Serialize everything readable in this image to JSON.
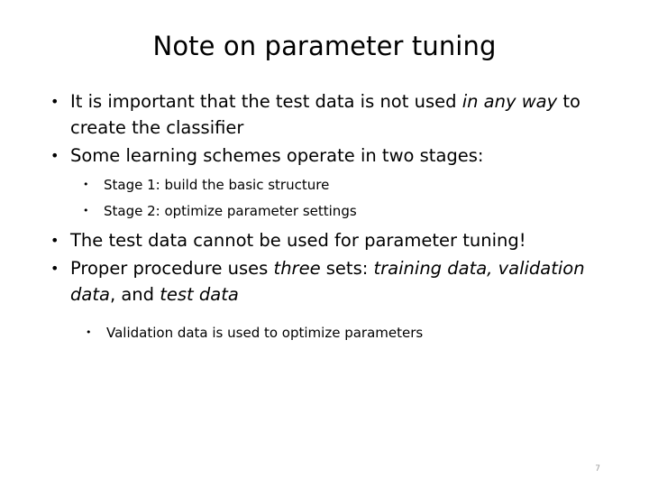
{
  "slide": {
    "title": "Note on parameter tuning",
    "page_number": "7",
    "background_color": "#ffffff",
    "text_color": "#000000",
    "page_number_color": "#9a9a9a",
    "bullets": [
      {
        "level": 1,
        "text_parts": [
          {
            "text": "It is important that the test data is not used ",
            "style": "normal"
          },
          {
            "text": "in any way",
            "style": "italic"
          },
          {
            "text": " to create the classifier",
            "style": "normal"
          }
        ],
        "plain_text": "It is important that the test data is not used in any way to create the classifier"
      },
      {
        "level": 1,
        "text_parts": [
          {
            "text": "Some learning schemes operate in two stages:",
            "style": "normal"
          }
        ],
        "plain_text": "Some learning schemes operate in two stages:"
      },
      {
        "level": 2,
        "text_parts": [
          {
            "text": "Stage 1: build the basic structure",
            "style": "normal"
          }
        ],
        "plain_text": "Stage 1: build the basic structure"
      },
      {
        "level": 2,
        "text_parts": [
          {
            "text": "Stage 2: optimize parameter settings",
            "style": "normal"
          }
        ],
        "plain_text": "Stage 2: optimize parameter settings"
      },
      {
        "level": 1,
        "text_parts": [
          {
            "text": "The test data cannot be used for parameter tuning!",
            "style": "normal"
          }
        ],
        "plain_text": "The test data cannot be used for parameter tuning!"
      },
      {
        "level": 1,
        "text_parts": [
          {
            "text": "Proper procedure uses ",
            "style": "normal"
          },
          {
            "text": "three",
            "style": "italic"
          },
          {
            "text": " sets: ",
            "style": "normal"
          },
          {
            "text": "training data, validation data",
            "style": "italic"
          },
          {
            "text": ", and ",
            "style": "normal"
          },
          {
            "text": "test data",
            "style": "italic"
          }
        ],
        "plain_text": "Proper procedure uses three sets: training data, validation data, and test data"
      },
      {
        "level": 2,
        "text_parts": [
          {
            "text": "Validation data is used to optimize parameters",
            "style": "normal"
          }
        ],
        "plain_text": "Validation data is used to optimize parameters"
      }
    ]
  }
}
